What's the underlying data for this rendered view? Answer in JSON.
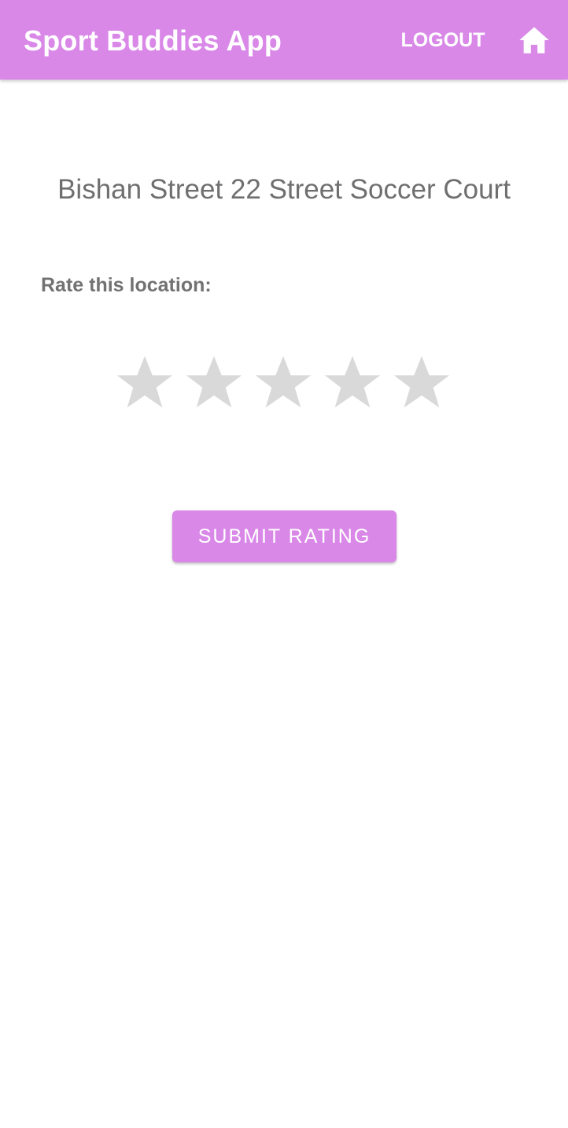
{
  "app_bar": {
    "title": "Sport Buddies App",
    "logout_label": "LOGOUT",
    "home_icon": "home-icon",
    "background_color": "#d988e8"
  },
  "content": {
    "location_name": "Bishan Street 22 Street Soccer Court",
    "rate_label": "Rate this location:",
    "rating": {
      "max_stars": 5,
      "selected": 0,
      "empty_star_color": "#d9d9d9",
      "star_icon": "star-icon"
    },
    "submit_label": "SUBMIT RATING"
  }
}
